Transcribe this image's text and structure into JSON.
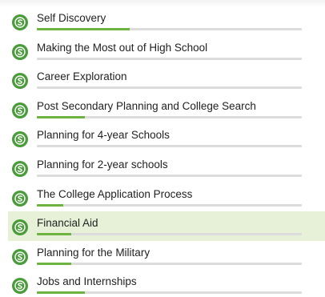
{
  "colors": {
    "brand": "#4a9b3a",
    "progress_fill": "#6cb33f",
    "progress_track": "#dcdcdc",
    "selected_row": "#e6f1d8"
  },
  "module_icon": "naviance-s-badge-icon",
  "modules": [
    {
      "label": "Self Discovery",
      "progress": 0.35
    },
    {
      "label": "Making the Most out of High School",
      "progress": 0
    },
    {
      "label": "Career Exploration",
      "progress": 0
    },
    {
      "label": "Post Secondary Planning and College Search",
      "progress": 0.18
    },
    {
      "label": "Planning for 4-year Schools",
      "progress": 0
    },
    {
      "label": "Planning for 2-year schools",
      "progress": 0
    },
    {
      "label": "The College Application Process",
      "progress": 0.1
    },
    {
      "label": "Financial Aid",
      "progress": 0.13,
      "selected": true
    },
    {
      "label": "Planning for the Military",
      "progress": 0.13
    },
    {
      "label": "Jobs and Internships",
      "progress": 0.18
    }
  ]
}
